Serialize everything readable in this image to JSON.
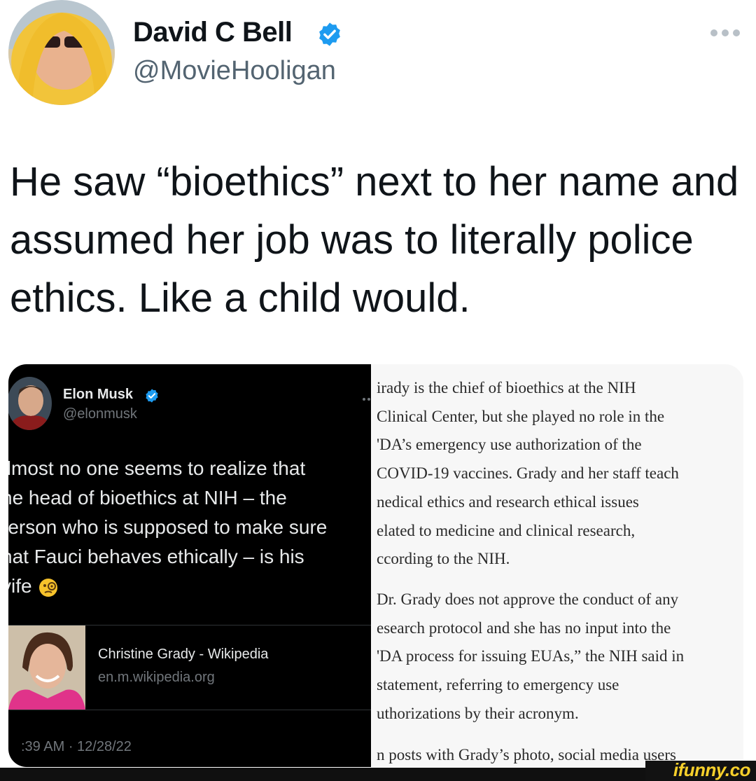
{
  "tweet": {
    "display_name": "David C Bell",
    "handle": "@MovieHooligan",
    "text": "He saw “bioethics” next to her name and assumed her job was to literally police ethics. Like a child would.",
    "more_icon": "more-horizontal-icon",
    "verified_icon": "verified-badge-icon"
  },
  "embedded_tweet": {
    "display_name": "Elon Musk",
    "handle": "@elonmusk",
    "text_lines": [
      "\\lmost no one seems to realize that",
      "he head of bioethics at NIH – the",
      ")erson who is supposed to make sure",
      "hat Fauci behaves ethically – is his",
      "vife"
    ],
    "emoji": "face-with-monocle-icon",
    "link_card": {
      "title": "Christine Grady - Wikipedia",
      "domain": "en.m.wikipedia.org"
    },
    "timestamp": ":39 AM · 12/28/22"
  },
  "article": {
    "paragraphs": [
      [
        "irady is the chief of bioethics at the NIH",
        "Clinical Center, but she played no role in the",
        "'DA’s emergency use authorization of the",
        "COVID-19 vaccines. Grady and her staff teach",
        "nedical ethics and research ethical issues",
        "elated to medicine and clinical research,",
        "ccording to the NIH."
      ],
      [
        "Dr. Grady does not approve the conduct of any",
        "esearch protocol and she has no input into the",
        "'DA process for issuing EUAs,” the NIH said in",
        " statement, referring to emergency use",
        "uthorizations by their acronym."
      ],
      [
        "n posts with Grady’s photo, social media users"
      ]
    ]
  },
  "watermark": "ifunny.co",
  "colors": {
    "verified": "#1d9bf0",
    "dark_bg": "#000000",
    "watermark": "#f7d02b"
  }
}
